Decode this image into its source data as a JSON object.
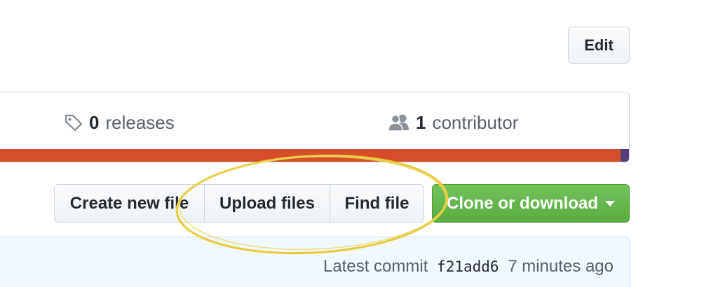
{
  "header": {
    "edit_label": "Edit"
  },
  "summary": {
    "releases": {
      "count": "0",
      "label": "releases",
      "icon": "tag-icon"
    },
    "contributors": {
      "count": "1",
      "label": "contributor",
      "icon": "people-icon"
    }
  },
  "language_bar": {
    "primary_color": "#d54e29",
    "secondary_color": "#563d7c"
  },
  "file_actions": {
    "create_label": "Create new file",
    "upload_label": "Upload files",
    "find_label": "Find file",
    "clone_label": "Clone or download",
    "clone_color": "#5fb545"
  },
  "commit": {
    "prefix": "Latest commit",
    "sha": "f21add6",
    "time": "7 minutes ago"
  },
  "annotation": {
    "color": "#e8cc3f"
  }
}
